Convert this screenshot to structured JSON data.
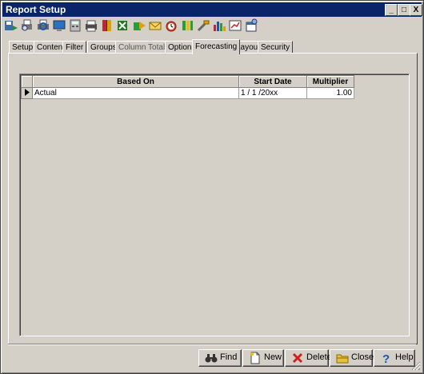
{
  "window": {
    "title": "Report Setup"
  },
  "titlebar_buttons": {
    "minimize": "_",
    "maximize": "□",
    "close": "X"
  },
  "toolbar": {
    "icons": [
      "save-and-run-icon",
      "print-preview-icon",
      "print-setup-icon",
      "monitor-icon",
      "calculator-icon",
      "printer-icon",
      "report-book-icon",
      "export-spreadsheet-icon",
      "export-arrow-icon",
      "email-icon",
      "alarm-clock-icon",
      "columns-icon",
      "tools-icon",
      "bar-chart-icon",
      "chart-wizard-icon",
      "schedule-icon"
    ]
  },
  "tabs": [
    {
      "label": "Setup"
    },
    {
      "label": "Content"
    },
    {
      "label": "Filter"
    },
    {
      "label": "Groups"
    },
    {
      "label": "Column Totals"
    },
    {
      "label": "Options"
    },
    {
      "label": "Forecasting"
    },
    {
      "label": "Layout"
    },
    {
      "label": "Security"
    }
  ],
  "grid": {
    "columns": [
      "Based On",
      "Start Date",
      "Multiplier"
    ],
    "rows": [
      {
        "based_on": "Actual",
        "start_date": "1 / 1 /20xx",
        "multiplier": "1.00"
      }
    ]
  },
  "buttons": {
    "find": "Find",
    "new": "New",
    "delete": "Delete",
    "close": "Close",
    "help": "Help"
  }
}
